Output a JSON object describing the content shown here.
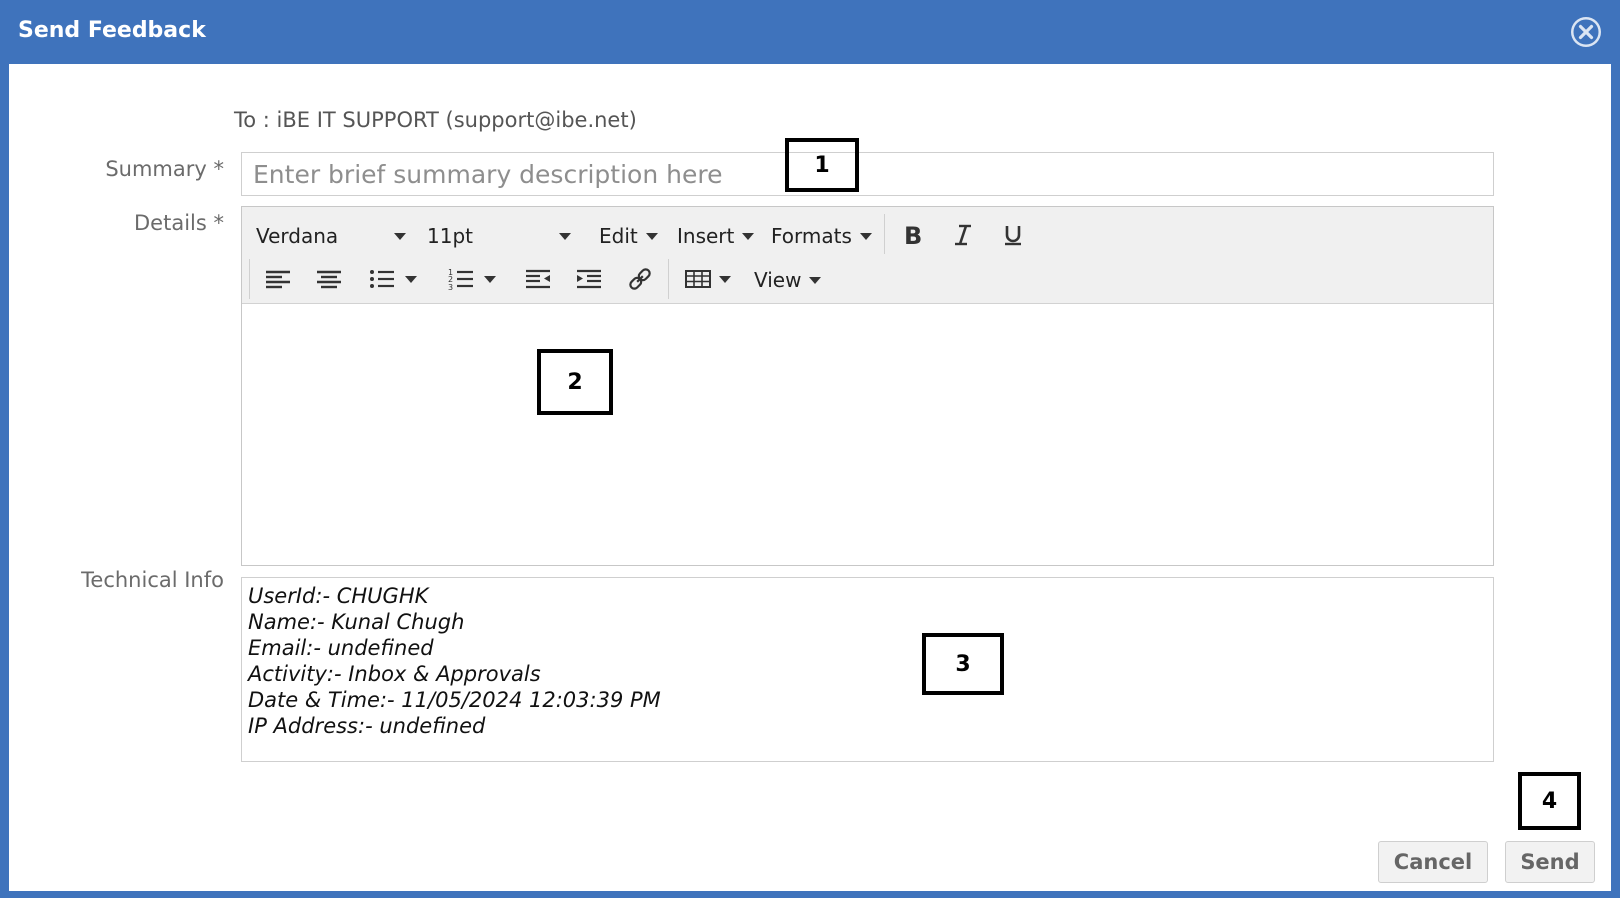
{
  "dialog": {
    "title": "Send Feedback"
  },
  "form": {
    "to_line": "To : iBE IT SUPPORT (support@ibe.net)",
    "summary_label": "Summary *",
    "summary_placeholder": "Enter brief summary description here",
    "details_label": "Details *",
    "technical_label": "Technical Info"
  },
  "toolbar": {
    "font_family": "Verdana",
    "font_size": "11pt",
    "menus": [
      "Edit",
      "Insert",
      "Formats",
      "View"
    ],
    "icons": [
      "bold-icon",
      "italic-icon",
      "underline-icon",
      "align-left-icon",
      "align-center-icon",
      "bullet-list-icon",
      "numbered-list-icon",
      "outdent-icon",
      "indent-icon",
      "link-icon",
      "table-icon"
    ]
  },
  "technical_info": {
    "lines": [
      "UserId:- CHUGHK",
      "Name:- Kunal Chugh",
      "Email:- undefined",
      "Activity:- Inbox & Approvals",
      "Date & Time:- 11/05/2024 12:03:39 PM",
      "IP Address:- undefined"
    ]
  },
  "buttons": {
    "cancel": "Cancel",
    "send": "Send"
  },
  "markers": {
    "m1": "1",
    "m2": "2",
    "m3": "3",
    "m4": "4"
  },
  "colors": {
    "header": "#3f73bc",
    "close_bg": "#dbe5f3"
  }
}
